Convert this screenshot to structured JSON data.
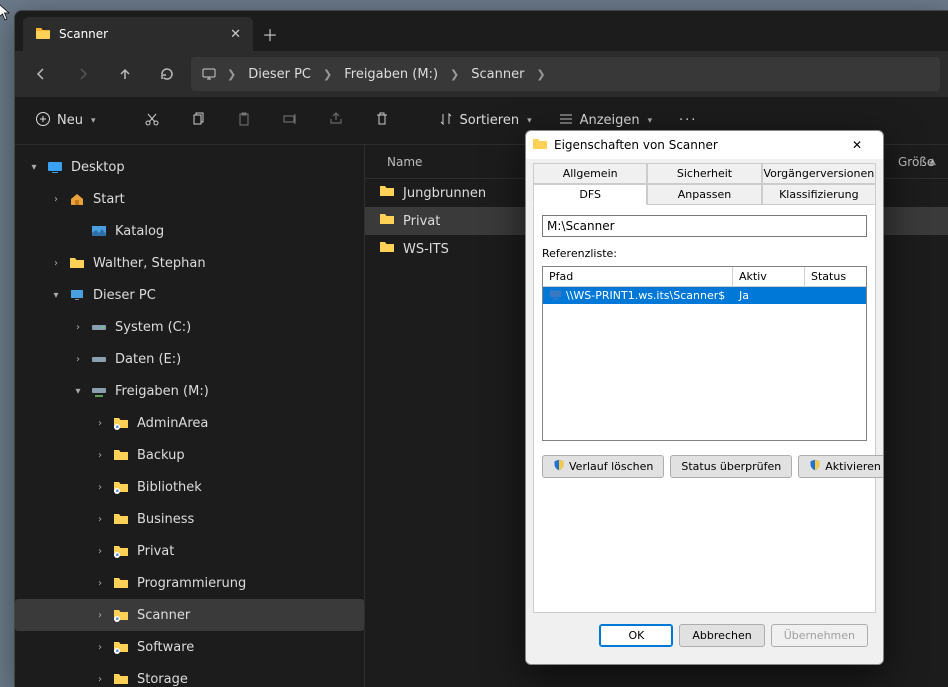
{
  "window": {
    "tab_title": "Scanner"
  },
  "breadcrumb": {
    "seg1": "Dieser PC",
    "seg2": "Freigaben (M:)",
    "seg3": "Scanner"
  },
  "toolbar": {
    "new_label": "Neu",
    "sort_label": "Sortieren",
    "view_label": "Anzeigen"
  },
  "columns": {
    "name": "Name",
    "size": "Größe"
  },
  "tree": {
    "desktop": "Desktop",
    "start": "Start",
    "katalog": "Katalog",
    "walther": "Walther, Stephan",
    "thispc": "Dieser PC",
    "system_c": "System (C:)",
    "daten_e": "Daten (E:)",
    "freigaben_m": "Freigaben (M:)",
    "adminarea": "AdminArea",
    "backup": "Backup",
    "bibliothek": "Bibliothek",
    "business": "Business",
    "privat": "Privat",
    "programmierung": "Programmierung",
    "scanner": "Scanner",
    "software": "Software",
    "storage": "Storage"
  },
  "files": {
    "f1": "Jungbrunnen",
    "f2": "Privat",
    "f3": "WS-ITS"
  },
  "dialog": {
    "title": "Eigenschaften von Scanner",
    "tabs": {
      "allgemein": "Allgemein",
      "sicherheit": "Sicherheit",
      "vorgaenger": "Vorgängerversionen",
      "dfs": "DFS",
      "anpassen": "Anpassen",
      "klass": "Klassifizierung"
    },
    "path_value": "M:\\Scanner",
    "ref_label": "Referenzliste:",
    "headers": {
      "pfad": "Pfad",
      "aktiv": "Aktiv",
      "status": "Status"
    },
    "row": {
      "path": "\\\\WS-PRINT1.ws.its\\Scanner$",
      "active": "Ja",
      "status": ""
    },
    "btn_verlauf": "Verlauf löschen",
    "btn_status": "Status überprüfen",
    "btn_aktivieren": "Aktivieren",
    "ok": "OK",
    "abbrechen": "Abbrechen",
    "uebernehmen": "Übernehmen"
  }
}
